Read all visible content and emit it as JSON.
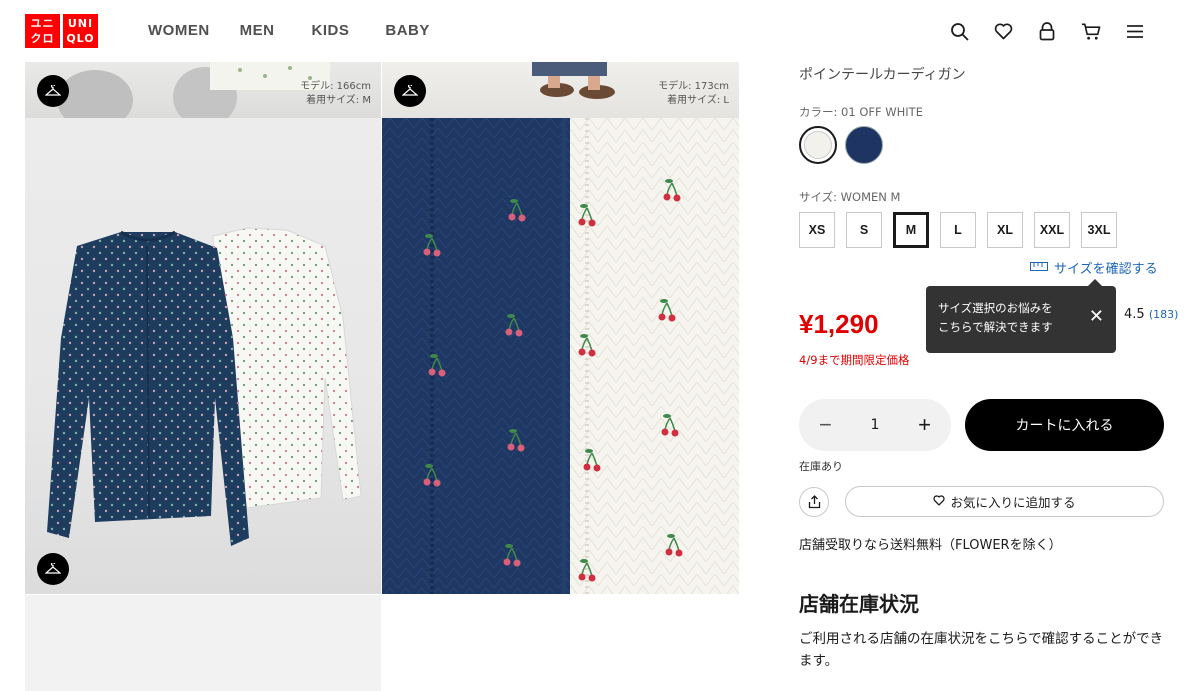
{
  "header": {
    "logo_text": [
      "ユニ",
      "クロ",
      "UNI",
      "QLO"
    ],
    "nav": [
      "WOMEN",
      "MEN",
      "KIDS",
      "BABY"
    ],
    "icons": [
      "search-icon",
      "heart-icon",
      "account-icon",
      "cart-icon",
      "menu-icon"
    ]
  },
  "gallery": {
    "tile1_model": "モデル: 166cm",
    "tile1_size": "着用サイズ: M",
    "tile2_model": "モデル: 173cm",
    "tile2_size": "着用サイズ: L"
  },
  "product": {
    "name": "ポインテールカーディガン",
    "color_label": "カラー: 01 OFF WHITE",
    "size_label": "サイズ: WOMEN M",
    "sizes": [
      "XS",
      "S",
      "M",
      "L",
      "XL",
      "XXL",
      "3XL"
    ],
    "selected_size": "M",
    "size_check": "サイズを確認する",
    "price": "¥1,290",
    "promo": "4/9まで期間限定価格",
    "rating_value": "4.5",
    "rating_count": "(183)",
    "tooltip": "サイズ選択のお悩みを\nこちらで解決できます",
    "quantity": "1",
    "cart_button": "カートに入れる",
    "stock": "在庫あり",
    "favorite_button": "お気に入りに追加する",
    "free_shipping": "店舗受取りなら送料無料（FLOWERを除く）",
    "store_title": "店舗在庫状況",
    "store_desc": "ご利用される店舗の在庫状況をこちらで確認することができます。"
  },
  "colors": {
    "brand_red": "#ff0000",
    "price_red": "#e00000",
    "link_blue": "#1d65b6",
    "navy": "#1e3563"
  }
}
